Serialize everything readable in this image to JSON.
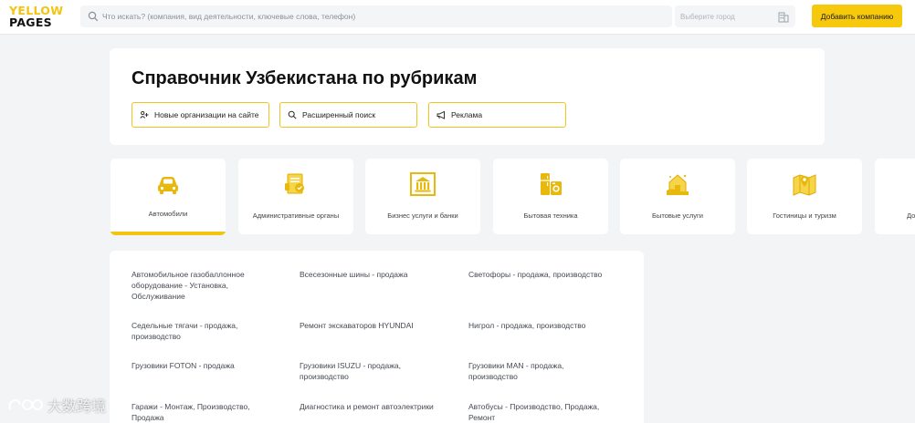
{
  "header": {
    "logo_line1": "YELLOW",
    "logo_line2": "PAGES",
    "search_placeholder": "Что искать? (компания, вид деятельности, ключевые слова, телефон)",
    "city_placeholder": "Выберите город",
    "add_company_label": "Добавить компанию"
  },
  "hero": {
    "title": "Справочник Узбекистана по рубрикам",
    "buttons": [
      {
        "label": "Новые организации на сайте",
        "icon": "new-orgs-icon"
      },
      {
        "label": "Расширенный поиск",
        "icon": "search-icon"
      },
      {
        "label": "Реклама",
        "icon": "megaphone-icon"
      }
    ]
  },
  "categories": [
    {
      "label": "Автомобили",
      "icon": "car-icon",
      "active": true
    },
    {
      "label": "Административные органы",
      "icon": "admin-document-icon",
      "active": false
    },
    {
      "label": "Бизнес услуги и банки",
      "icon": "bank-icon",
      "active": false
    },
    {
      "label": "Бытовая техника",
      "icon": "appliances-icon",
      "active": false
    },
    {
      "label": "Бытовые услуги",
      "icon": "household-services-icon",
      "active": false
    },
    {
      "label": "Гостиницы и туризм",
      "icon": "map-location-icon",
      "active": false
    },
    {
      "label": "До",
      "icon": "",
      "active": false
    }
  ],
  "subcategories": [
    "Автомобильное газобаллонное оборудование - Установка, Обслуживание",
    "Всесезонные шины - продажа",
    "Светофоры - продажа, производство",
    "Седельные тягачи - продажа, производство",
    "Ремонт экскаваторов HYUNDAI",
    "Нигрол - продажа, производство",
    "Грузовики FOTON - продажа",
    "Грузовики ISUZU - продажа, производство",
    "Грузовики MAN - продажа, производство",
    "Гаражи - Монтаж, Производство, Продажа",
    "Диагностика и ремонт автоэлектрики",
    "Автобусы - Производство, Продажа, Ремонт"
  ],
  "watermark": "大数跨境",
  "colors": {
    "accent": "#f2c511",
    "button": "#f7c90d",
    "background": "#f3f4f6"
  }
}
